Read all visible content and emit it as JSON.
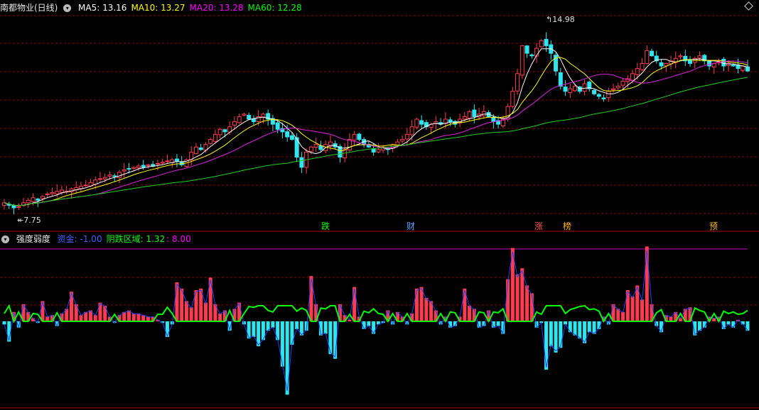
{
  "main_panel": {
    "title": "南都物业(日线)",
    "ma_labels": [
      {
        "text": "MA5: 13.16",
        "color": "#ffffff"
      },
      {
        "text": "MA10: 13.27",
        "color": "#ffff00"
      },
      {
        "text": "MA20: 13.28",
        "color": "#ff00ff"
      },
      {
        "text": "MA60: 12.28",
        "color": "#00ff00"
      }
    ],
    "high_label": "14.98",
    "low_label": "7.75",
    "events": [
      {
        "text": "跌",
        "color": "#00ff00"
      },
      {
        "text": "财",
        "color": "#5aa0ff"
      },
      {
        "text": "涨",
        "color": "#ff5050"
      },
      {
        "text": "榜",
        "color": "#ffb000"
      },
      {
        "text": "预",
        "color": "#ffb000"
      }
    ]
  },
  "sub_panel": {
    "title": "强度弱度",
    "labels": [
      {
        "text": "资金: -1.00",
        "color": "#4060ff"
      },
      {
        "text": "阴跌区域: 1.32",
        "color": "#00ff00"
      },
      {
        "text": ": 8.00",
        "color": "#ff00ff"
      }
    ]
  },
  "colors": {
    "up": "#ff3b50",
    "down": "#2ee6f0",
    "grid": "#8a0000",
    "ma5": "#ffffff",
    "ma10": "#ffff00",
    "ma20": "#e020e0",
    "ma60": "#20d020",
    "zone": "#00ff00",
    "fund": "#2040ff",
    "ref": "#c000c0"
  },
  "chart_data": [
    {
      "type": "candlestick",
      "title": "南都物业(日线)",
      "price_range": [
        7.75,
        14.98
      ],
      "closes": [
        8.1,
        8.0,
        7.9,
        7.95,
        8.1,
        8.2,
        8.3,
        8.2,
        8.35,
        8.45,
        8.5,
        8.55,
        8.6,
        8.55,
        8.65,
        8.7,
        8.75,
        8.8,
        8.9,
        9.0,
        9.05,
        9.1,
        9.2,
        9.15,
        9.3,
        9.4,
        9.45,
        9.5,
        9.55,
        9.5,
        9.6,
        9.55,
        9.65,
        9.7,
        9.75,
        9.8,
        9.75,
        9.6,
        9.8,
        10.1,
        10.3,
        10.2,
        10.4,
        10.6,
        10.8,
        11.0,
        10.9,
        11.1,
        11.3,
        11.5,
        11.6,
        11.4,
        11.3,
        11.5,
        11.6,
        11.4,
        11.2,
        11.0,
        10.9,
        10.7,
        10.6,
        9.9,
        9.5,
        10.1,
        10.3,
        10.4,
        10.2,
        10.4,
        10.5,
        10.3,
        9.9,
        10.2,
        10.6,
        10.8,
        10.6,
        10.4,
        10.3,
        10.1,
        10.2,
        10.3,
        10.2,
        10.4,
        10.5,
        10.6,
        10.8,
        11.1,
        11.4,
        11.2,
        11.1,
        11.2,
        11.3,
        11.2,
        11.4,
        11.3,
        11.2,
        11.4,
        11.5,
        11.7,
        11.5,
        11.6,
        11.7,
        11.5,
        11.3,
        11.2,
        11.4,
        11.9,
        12.5,
        13.2,
        14.3,
        14.0,
        13.9,
        14.2,
        14.5,
        14.3,
        14.0,
        13.3,
        12.7,
        12.5,
        12.6,
        12.7,
        12.5,
        12.8,
        12.6,
        12.4,
        12.3,
        12.2,
        12.5,
        12.6,
        12.7,
        12.9,
        13.0,
        13.2,
        13.4,
        13.6,
        14.1,
        13.9,
        13.7,
        13.5,
        13.6,
        13.7,
        13.8,
        13.9,
        13.7,
        13.6,
        13.8,
        13.9,
        13.7,
        13.5,
        13.6,
        13.7,
        13.5,
        13.6,
        13.5,
        13.4,
        13.5,
        13.3
      ]
    },
    {
      "type": "bar",
      "title": "强度弱度",
      "values": [
        -0.2,
        -1.3,
        0.6,
        -0.4,
        1.1,
        0.6,
        0.2,
        -0.1,
        1.3,
        0.3,
        0.4,
        -0.3,
        0.5,
        0.8,
        1.9,
        1.1,
        0.4,
        0.6,
        0.7,
        0.4,
        1.2,
        1.0,
        0.3,
        -0.1,
        0.4,
        0.6,
        0.7,
        0.5,
        0.5,
        0.4,
        0.3,
        0.3,
        0.1,
        -0.1,
        -1.0,
        -0.2,
        2.5,
        2.1,
        1.3,
        0.9,
        2.0,
        2.1,
        1.2,
        2.8,
        1.1,
        0.5,
        0.7,
        -0.6,
        0.8,
        1.2,
        -0.2,
        -1.1,
        -1.0,
        -1.6,
        -1.2,
        -0.6,
        -0.4,
        -1.2,
        -2.9,
        -4.7,
        -1.5,
        -0.5,
        -0.9,
        -0.6,
        2.9,
        1.1,
        -0.9,
        -0.8,
        -2.1,
        -2.4,
        1.1,
        0.4,
        0.1,
        2.2,
        0.3,
        -0.5,
        -0.3,
        -0.8,
        -0.2,
        -0.1,
        0.7,
        -0.2,
        0.6,
        0.3,
        -0.2,
        0.5,
        2.1,
        2.2,
        1.5,
        1.3,
        0.7,
        -0.2,
        0.3,
        -0.4,
        -0.3,
        0.3,
        2.1,
        1.0,
        0.8,
        -0.4,
        -0.3,
        0.7,
        -0.4,
        -0.3,
        -0.8,
        2.7,
        4.7,
        3.0,
        3.4,
        2.3,
        1.8,
        -0.4,
        -0.1,
        -3.1,
        -1.6,
        -2.0,
        -1.7,
        -0.2,
        -0.7,
        -0.9,
        -1.1,
        -1.4,
        -0.7,
        -0.8,
        -0.5,
        0.3,
        -0.2,
        1.1,
        0.8,
        0.6,
        2.0,
        1.6,
        2.3,
        1.4,
        4.8,
        1.1,
        -0.3,
        -0.7,
        0.4,
        0.3,
        0.6,
        0.2,
        0.8,
        0.9,
        -0.9,
        -0.6,
        -0.4,
        0.3,
        0.2,
        0.3,
        -0.5,
        -0.2,
        -0.4,
        0.1,
        -0.2,
        -0.6
      ],
      "reference_level": 8.0
    }
  ]
}
